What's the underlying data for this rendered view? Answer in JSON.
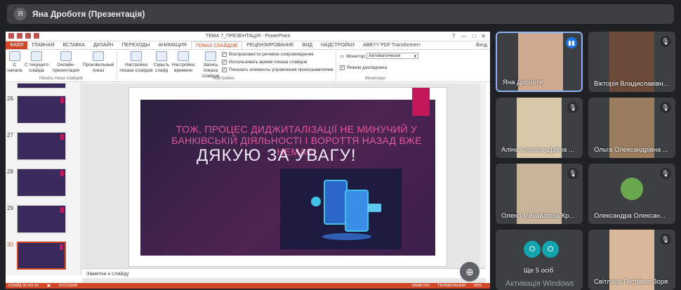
{
  "meeting": {
    "presenter_initial": "Я",
    "presenter_title": "Яна Дроботя (Презентація)"
  },
  "powerpoint": {
    "window_title": "ТЕМА 7_ПРЕЗЕНТАЦІЯ - PowerPoint",
    "window_controls": [
      "?",
      "—",
      "□",
      "✕"
    ],
    "tabs": [
      "ФАЙЛ",
      "ГЛАВНАЯ",
      "ВСТАВКА",
      "ДИЗАЙН",
      "ПЕРЕХОДЫ",
      "АНИМАЦИЯ",
      "ПОКАЗ СЛАЙДОВ",
      "РЕЦЕНЗИРОВАНИЕ",
      "ВИД",
      "НАДСТРОЙКИ",
      "ABBYY PDF Transformer+"
    ],
    "active_tab": "ПОКАЗ СЛАЙДОВ",
    "login": "Вход",
    "ribbon": {
      "btn_start": "С начала",
      "btn_current": "С текущего слайда",
      "btn_online": "Онлайн-презентация",
      "btn_custom": "Произвольный показ",
      "group_start": "Начать показ слайдов",
      "btn_setup": "Настройка показа слайдов",
      "btn_hide": "Скрыть слайд",
      "btn_timing": "Настройка времени",
      "btn_record": "Запись показа слайдов",
      "chk_narration": "Воспроизвести речевое сопровождение",
      "chk_timings": "Использовать время показа слайдов",
      "chk_controls": "Показать элементы управления проигрывателем",
      "group_setup": "Настройка",
      "monitor_label": "Монитор:",
      "monitor_value": "Автоматически",
      "chk_presenter": "Режим докладчика",
      "group_monitors": "Мониторы"
    },
    "thumbnails": [
      {
        "num": "26"
      },
      {
        "num": "27"
      },
      {
        "num": "28"
      },
      {
        "num": "29"
      },
      {
        "num": "30"
      }
    ],
    "selected_slide_num": "30",
    "slide": {
      "headline": "ТОЖ, ПРОЦЕС ДИДЖИТАЛІЗАЦІЇ НЕ МИНУЧИЙ У БАНКІВСЬКІЙ ДІЯЛЬНОСТІ І ВОРОТТЯ НАЗАД ВЖЕ НЕМАЄ!",
      "thanks": "ДЯКУЮ ЗА УВАГУ!"
    },
    "notes_placeholder": "Заметки к слайду",
    "status": {
      "slide_counter": "СЛАЙД 30 ИЗ 30",
      "language": "РУССКИЙ",
      "notes": "ЗАМЕТКИ",
      "comments": "ПРИМЕЧАНИЯ",
      "zoom": "66%"
    }
  },
  "participants": [
    {
      "name": "Яна Дроботя",
      "muted": false,
      "speaking": true,
      "photo_color": "#cfa98f"
    },
    {
      "name": "Вікторія Владиславівн...",
      "muted": true,
      "speaking": false,
      "photo_color": "#6b4a3a"
    },
    {
      "name": "Аліна Олександрівна ...",
      "muted": true,
      "speaking": false,
      "photo_color": "#d8c7a8"
    },
    {
      "name": "Ольга Олександрівна ...",
      "muted": true,
      "speaking": false,
      "photo_color": "#9a7d5e"
    },
    {
      "name": "Олена Михайлівна Кр...",
      "muted": true,
      "speaking": false,
      "photo_color": "#c8b49a"
    },
    {
      "name": "Олександра Олексан...",
      "muted": true,
      "speaking": false,
      "photo_color": "#6aa84f"
    },
    {
      "name": "Ще 5 осіб",
      "more_initials": [
        "O",
        "O"
      ]
    },
    {
      "name": "Світлана Петрівна Зоря",
      "muted": true,
      "speaking": false,
      "photo_color": "#d9b79a"
    }
  ],
  "activation_text": "Активація Windows"
}
